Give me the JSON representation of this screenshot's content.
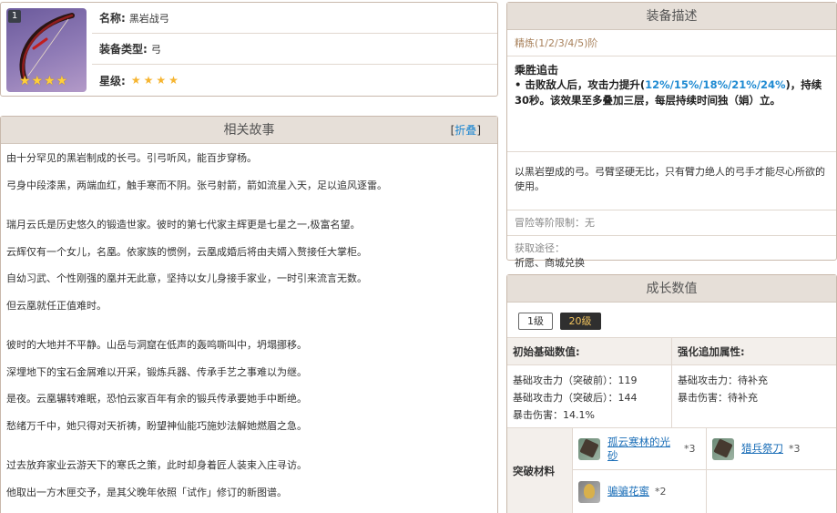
{
  "item": {
    "level_badge": "1",
    "name_label": "名称:",
    "name": "黑岩战弓",
    "type_label": "装备类型:",
    "type": "弓",
    "rarity_label": "星级:",
    "rarity_stars": 4,
    "stars_glyph": "★★★★"
  },
  "story": {
    "title": "相关故事",
    "toggle_open": "[",
    "toggle_label": "折叠",
    "toggle_close": "]",
    "paragraphs": [
      "由十分罕见的黑岩制成的长弓。引弓听风，能百步穿杨。",
      "弓身中段漆黑，两端血红，触手寒而不阴。张弓射箭，箭如流星入天，足以追风逐雷。",
      "",
      "瑞月云氏是历史悠久的锻造世家。彼时的第七代家主辉更是七星之一,极富名望。",
      "云辉仅有一个女儿，名凰。依家族的惯例，云凰成婚后将由夫婿入赘接任大掌柜。",
      "自幼习武、个性刚强的凰并无此意，坚持以女儿身接手家业，一时引来流言无数。",
      "但云凰就任正值难时。",
      "",
      "彼时的大地并不平静。山岳与洞窟在低声的轰鸣嘶叫中，坍塌挪移。",
      "深埋地下的宝石金屑难以开采，锻炼兵器、传承手艺之事难以为继。",
      "是夜。云凰辗转难眠，恐怕云家百年有余的锻兵传承要她手中断绝。",
      "愁绪万千中，她只得对天祈祷，盼望神仙能巧施妙法解她燃眉之急。",
      "",
      "过去放弃家业云游天下的寒氏之策，此时却身着匠人装束入庄寻访。",
      "他取出一方木匣交予，是其父晚年依照「试作」修订的新图谱。"
    ]
  },
  "description": {
    "title": "装备描述",
    "refine": "精炼(1/2/3/4/5)阶",
    "skill_name": "乘胜追击",
    "skill_pre": "• 击败敌人后，攻击力提升(",
    "skill_values": "12%/15%/18%/21%/24%",
    "skill_post": ")，持续30秒。该效果至多叠加三层，每层持续时间独（娟）立。",
    "lore": "以黑岩塑成的弓。弓臂坚硬无比，只有臂力绝人的弓手才能尽心所欲的使用。",
    "limit": "冒险等阶限制：无",
    "obtain_label": "获取途径：",
    "obtain_sources": "祈愿、商城兑换"
  },
  "growth": {
    "title": "成长数值",
    "tabs": [
      "1级",
      "20级"
    ],
    "active_tab": "20级",
    "base_header": "初始基础数值:",
    "base_lines": [
      "基础攻击力（突破前）：119",
      "基础攻击力（突破后）：144",
      "暴击伤害：14.1%"
    ],
    "bonus_header": "强化追加属性:",
    "bonus_lines": [
      "基础攻击力：待补充",
      "暴击伤害：待补充"
    ],
    "materials_label": "突破材料",
    "materials": [
      {
        "name": "孤云寒林的光砂",
        "qty": "*3",
        "icon": "sand-icon"
      },
      {
        "name": "猎兵祭刀",
        "qty": "*3",
        "icon": "ritual-blade-icon"
      },
      {
        "name": "骗骗花蜜",
        "qty": "*2",
        "icon": "nectar-icon"
      }
    ]
  },
  "colors": {
    "accent": "#1c86d1",
    "header_bg": "#e6dfd8",
    "star": "#f6b531",
    "refine": "#a8815b",
    "active_tab_text": "#f2c45e"
  }
}
